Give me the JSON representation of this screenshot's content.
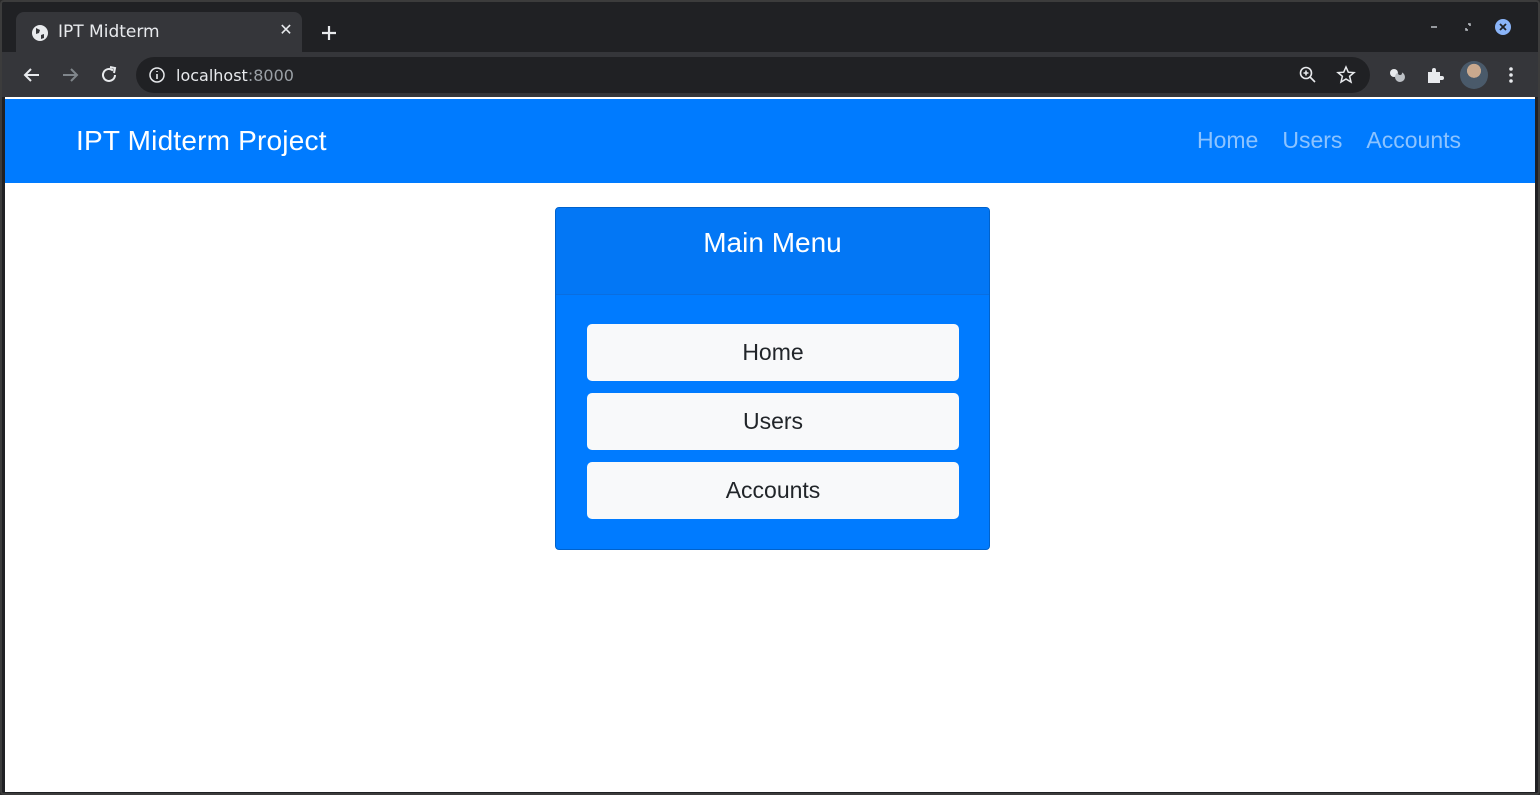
{
  "browser": {
    "tab_title": "IPT Midterm",
    "tab_close_glyph": "✕",
    "url_host": "localhost",
    "url_port": ":8000",
    "icons": [
      "globe-icon",
      "close-icon",
      "plus-icon",
      "minimize-icon",
      "maximize-icon",
      "window-close-icon",
      "back-arrow-icon",
      "forward-arrow-icon",
      "reload-icon",
      "info-icon",
      "zoom-icon",
      "star-icon",
      "extension-icon",
      "puzzle-icon",
      "avatar",
      "kebab-menu-icon"
    ]
  },
  "navbar": {
    "brand": "IPT Midterm Project",
    "links": [
      "Home",
      "Users",
      "Accounts"
    ]
  },
  "menu": {
    "title": "Main Menu",
    "buttons": [
      "Home",
      "Users",
      "Accounts"
    ]
  },
  "colors": {
    "primary": "#007bff",
    "light_button": "#f8f9fa",
    "button_text": "#212529"
  }
}
